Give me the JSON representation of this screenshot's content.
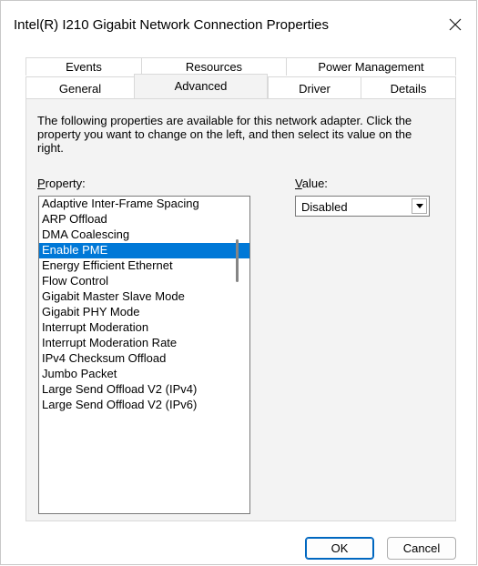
{
  "window": {
    "title": "Intel(R) I210 Gigabit Network Connection Properties",
    "close_icon": "close-icon"
  },
  "tabs": {
    "row1": [
      {
        "label": "Events"
      },
      {
        "label": "Resources"
      },
      {
        "label": "Power Management"
      }
    ],
    "row2": [
      {
        "label": "General"
      },
      {
        "label": "Advanced",
        "active": true
      },
      {
        "label": "Driver"
      },
      {
        "label": "Details"
      }
    ]
  },
  "advanced": {
    "description": "The following properties are available for this network adapter. Click the property you want to change on the left, and then select its value on the right.",
    "property_label_first": "P",
    "property_label_rest": "roperty:",
    "value_label_first": "V",
    "value_label_rest": "alue:",
    "properties": [
      "Adaptive Inter-Frame Spacing",
      "ARP Offload",
      "DMA Coalescing",
      "Enable PME",
      "Energy Efficient Ethernet",
      "Flow Control",
      "Gigabit Master Slave Mode",
      "Gigabit PHY Mode",
      "Interrupt Moderation",
      "Interrupt Moderation Rate",
      "IPv4 Checksum Offload",
      "Jumbo Packet",
      "Large Send Offload V2 (IPv4)",
      "Large Send Offload V2 (IPv6)"
    ],
    "selected_property": "Enable PME",
    "value_selected": "Disabled"
  },
  "buttons": {
    "ok": "OK",
    "cancel": "Cancel"
  },
  "colors": {
    "selection": "#0078d7",
    "panel_bg": "#f3f3f3",
    "ok_border": "#0067c0"
  }
}
